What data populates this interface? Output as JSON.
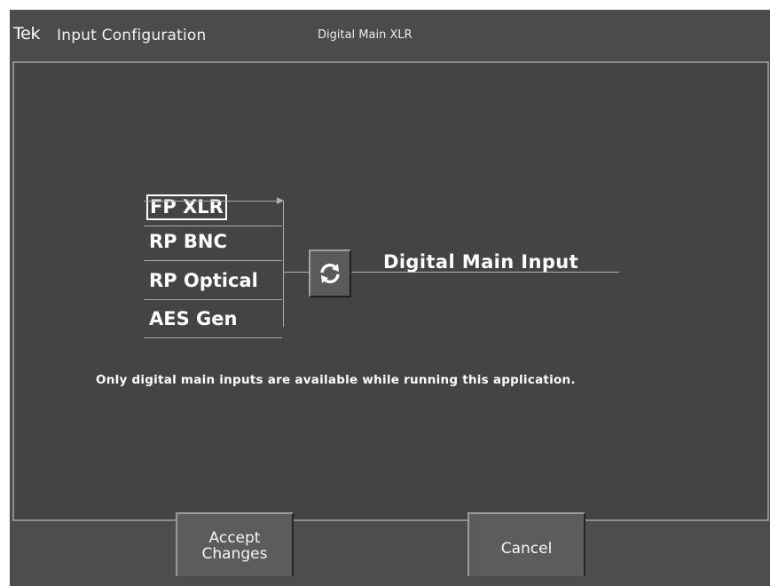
{
  "header": {
    "brand": "Tek",
    "title": "Input Configuration",
    "current_input": "Digital Main XLR"
  },
  "inputs": {
    "options": [
      {
        "label": "FP XLR",
        "selected": true
      },
      {
        "label": "RP BNC",
        "selected": false
      },
      {
        "label": "RP Optical",
        "selected": false
      },
      {
        "label": "AES Gen",
        "selected": false
      }
    ],
    "output_label": "Digital Main Input",
    "cycle_icon": "refresh-icon"
  },
  "notice": "Only digital main inputs are available while running this application.",
  "footer": {
    "accept_label": "Accept\nChanges",
    "cancel_label": "Cancel"
  },
  "colors": {
    "background": "#4a4a4a",
    "panel": "#444444",
    "panel_border": "#8e8e8e",
    "text": "#ffffff"
  }
}
